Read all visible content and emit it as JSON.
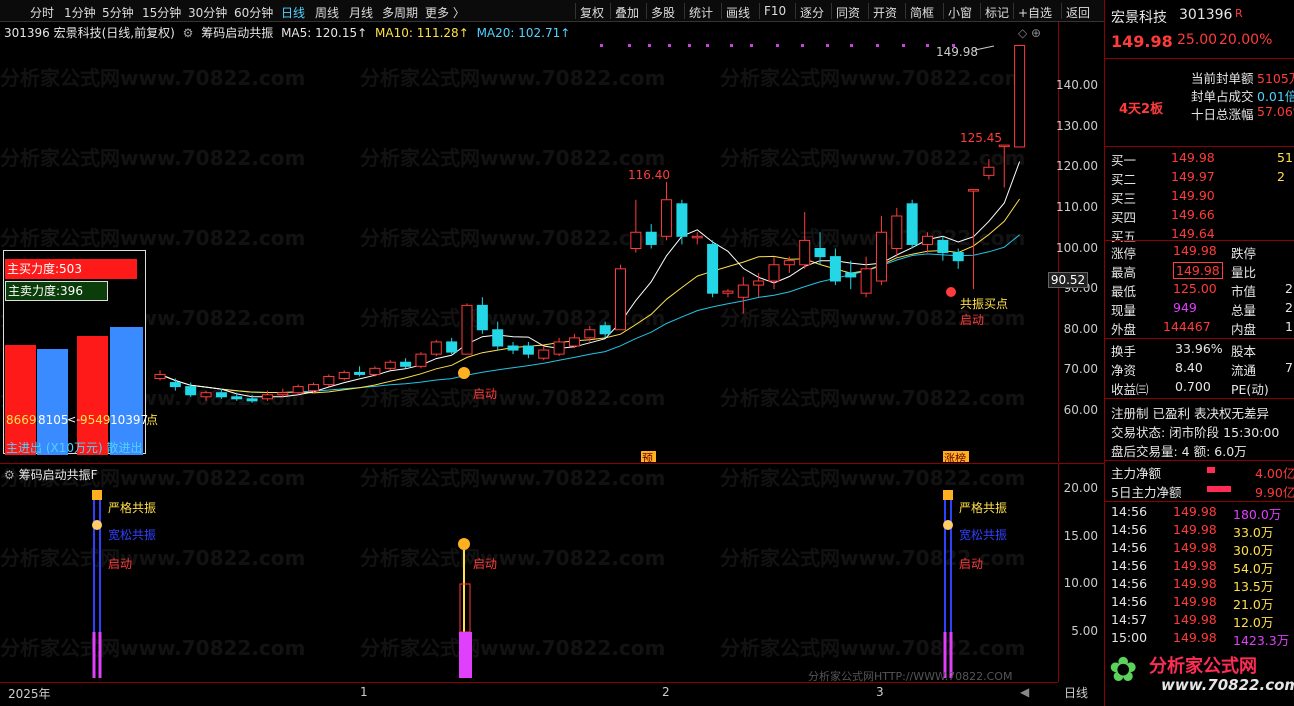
{
  "toolbar": {
    "periods": [
      "分时",
      "1分钟",
      "5分钟",
      "15分钟",
      "30分钟",
      "60分钟",
      "日线",
      "周线",
      "月线",
      "多周期",
      "更多 〉"
    ],
    "active_period": "日线",
    "tools": [
      "复权",
      "叠加",
      "多股",
      "统计",
      "画线",
      "F10",
      "逐分",
      "同资",
      "开资",
      "简框",
      "小窗",
      "标记",
      "+自选",
      "返回"
    ]
  },
  "info_line": {
    "title": "301396 宏景科技(日线,前复权)",
    "formula": "筹码启动共振",
    "ma5": "MA5: 120.15↑",
    "ma10": "MA10: 111.28↑",
    "ma20": "MA20: 102.71↑"
  },
  "main_chart": {
    "y_ticks": [
      "140.00",
      "130.00",
      "120.00",
      "110.00",
      "100.00",
      "90.00",
      "80.00",
      "70.00",
      "60.00"
    ],
    "cursor_price": "90.52",
    "annotations": {
      "high_label": "149.98",
      "peak_label": "116.40",
      "mid_label": "125.45",
      "signal_resonance": "共振买点",
      "signal_start": "启动",
      "signal_start2": "启动",
      "tag_pre": "预",
      "tag_limit": "涨榜"
    },
    "candles": [
      {
        "o": 68,
        "c": 69,
        "h": 70,
        "l": 67.5
      },
      {
        "o": 67,
        "c": 66,
        "h": 68,
        "l": 65
      },
      {
        "o": 66,
        "c": 64,
        "h": 67,
        "l": 63.5
      },
      {
        "o": 63.5,
        "c": 64.5,
        "h": 65,
        "l": 62.5
      },
      {
        "o": 64.5,
        "c": 63.5,
        "h": 65.5,
        "l": 63
      },
      {
        "o": 63.5,
        "c": 63,
        "h": 64.5,
        "l": 62.5
      },
      {
        "o": 63,
        "c": 62.5,
        "h": 64,
        "l": 62
      },
      {
        "o": 63,
        "c": 64,
        "h": 65,
        "l": 62.5
      },
      {
        "o": 64,
        "c": 64.5,
        "h": 65.5,
        "l": 63.5
      },
      {
        "o": 64.5,
        "c": 66,
        "h": 66.5,
        "l": 64
      },
      {
        "o": 65,
        "c": 66.5,
        "h": 67,
        "l": 64.5
      },
      {
        "o": 66.5,
        "c": 68.5,
        "h": 69,
        "l": 66
      },
      {
        "o": 68,
        "c": 69.5,
        "h": 70,
        "l": 67.5
      },
      {
        "o": 69.5,
        "c": 69,
        "h": 71,
        "l": 68.5
      },
      {
        "o": 69,
        "c": 70.5,
        "h": 71,
        "l": 68.5
      },
      {
        "o": 70.5,
        "c": 72,
        "h": 72.5,
        "l": 70
      },
      {
        "o": 72,
        "c": 71,
        "h": 73,
        "l": 70.5
      },
      {
        "o": 71,
        "c": 74,
        "h": 74.5,
        "l": 70.5
      },
      {
        "o": 74,
        "c": 77,
        "h": 77.5,
        "l": 73.5
      },
      {
        "o": 77,
        "c": 74.5,
        "h": 78,
        "l": 74
      },
      {
        "o": 74,
        "c": 86,
        "h": 86.5,
        "l": 74
      },
      {
        "o": 86,
        "c": 80,
        "h": 88,
        "l": 79
      },
      {
        "o": 80,
        "c": 76,
        "h": 82,
        "l": 75
      },
      {
        "o": 76,
        "c": 75,
        "h": 77,
        "l": 74
      },
      {
        "o": 76,
        "c": 74,
        "h": 77,
        "l": 73
      },
      {
        "o": 73,
        "c": 75,
        "h": 76,
        "l": 72.5
      },
      {
        "o": 74,
        "c": 77,
        "h": 78,
        "l": 73.5
      },
      {
        "o": 76,
        "c": 78,
        "h": 79,
        "l": 75.5
      },
      {
        "o": 78,
        "c": 80,
        "h": 81,
        "l": 77
      },
      {
        "o": 81,
        "c": 79,
        "h": 82,
        "l": 78
      },
      {
        "o": 80,
        "c": 95,
        "h": 96,
        "l": 80
      },
      {
        "o": 100,
        "c": 104,
        "h": 112,
        "l": 99
      },
      {
        "o": 104,
        "c": 101,
        "h": 106,
        "l": 100
      },
      {
        "o": 103,
        "c": 112,
        "h": 116.4,
        "l": 102
      },
      {
        "o": 111,
        "c": 103,
        "h": 112,
        "l": 101
      },
      {
        "o": 103,
        "c": 103,
        "h": 104,
        "l": 101
      },
      {
        "o": 101,
        "c": 89,
        "h": 102,
        "l": 88
      },
      {
        "o": 89,
        "c": 89.5,
        "h": 90,
        "l": 88
      },
      {
        "o": 88,
        "c": 91,
        "h": 93,
        "l": 84
      },
      {
        "o": 91,
        "c": 92,
        "h": 94,
        "l": 88
      },
      {
        "o": 92,
        "c": 96,
        "h": 98,
        "l": 90
      },
      {
        "o": 96,
        "c": 97,
        "h": 98,
        "l": 94
      },
      {
        "o": 96,
        "c": 102,
        "h": 109,
        "l": 95
      },
      {
        "o": 100,
        "c": 98,
        "h": 104,
        "l": 96
      },
      {
        "o": 98,
        "c": 92,
        "h": 100,
        "l": 91
      },
      {
        "o": 94,
        "c": 93,
        "h": 97,
        "l": 90
      },
      {
        "o": 89,
        "c": 95,
        "h": 98,
        "l": 88
      },
      {
        "o": 92,
        "c": 104,
        "h": 108,
        "l": 91
      },
      {
        "o": 100,
        "c": 108,
        "h": 110,
        "l": 98
      },
      {
        "o": 111,
        "c": 101,
        "h": 112,
        "l": 100
      },
      {
        "o": 101,
        "c": 103,
        "h": 104,
        "l": 99
      },
      {
        "o": 102,
        "c": 99,
        "h": 103,
        "l": 97
      },
      {
        "o": 99,
        "c": 97,
        "h": 100,
        "l": 95
      },
      {
        "o": 114.5,
        "c": 114.5,
        "h": 114.5,
        "l": 90
      },
      {
        "o": 118,
        "c": 120,
        "h": 122,
        "l": 117
      },
      {
        "o": 125.45,
        "c": 125.45,
        "h": 125.45,
        "l": 115
      },
      {
        "o": 125,
        "c": 149.98,
        "h": 149.98,
        "l": 125
      }
    ]
  },
  "legend": {
    "main_buy": "主买力度:503",
    "main_sell": "主卖力度:396",
    "bar1": "8669",
    "bar2": "8105",
    "bar3": "9549",
    "bar4": "10397",
    "cursor_text": "<--",
    "footer": "主进出 (X10万元) 散进出",
    "tail": "点"
  },
  "sub_chart": {
    "title": "筹码启动共振F",
    "y_ticks": [
      "20.00",
      "15.00",
      "10.00",
      "5.00"
    ],
    "labels": {
      "strict": "严格共振",
      "loose": "宽松共振",
      "start": "启动"
    },
    "footer_watermark": "分析家公式网HTTP://WWW.70822.COM"
  },
  "bottom_axis": {
    "year": "2025年",
    "m1": "1",
    "m2": "2",
    "m3": "3",
    "scale": "日线"
  },
  "right_panel": {
    "name": "宏景科技",
    "code": "301396",
    "badge": "R",
    "price": "149.98",
    "change": "25.00",
    "change_pct": "20.00%",
    "board": "4天2板",
    "seal_amount_label": "当前封单额",
    "seal_amount": "5105万",
    "seal_ratio_label": "封单占成交",
    "seal_ratio": "0.01倍",
    "ten_day_label": "十日总涨幅",
    "ten_day": "57.06%",
    "bids": [
      {
        "label": "买一",
        "price": "149.98",
        "vol": "51"
      },
      {
        "label": "买二",
        "price": "149.97",
        "vol": "2"
      },
      {
        "label": "买三",
        "price": "149.90",
        "vol": ""
      },
      {
        "label": "买四",
        "price": "149.66",
        "vol": ""
      },
      {
        "label": "买五",
        "price": "149.64",
        "vol": ""
      }
    ],
    "stats1": [
      {
        "l": "涨停",
        "v": "149.98",
        "l2": "跌停",
        "v2": ""
      },
      {
        "l": "最高",
        "v": "149.98",
        "l2": "量比",
        "v2": ""
      },
      {
        "l": "最低",
        "v": "125.00",
        "l2": "市值",
        "v2": "2"
      },
      {
        "l": "现量",
        "v": "949",
        "l2": "总量",
        "v2": "2"
      },
      {
        "l": "外盘",
        "v": "144467",
        "l2": "内盘",
        "v2": "1"
      }
    ],
    "stats2": [
      {
        "l": "换手",
        "v": "33.96%",
        "l2": "股本",
        "v2": ""
      },
      {
        "l": "净资",
        "v": "8.40",
        "l2": "流通",
        "v2": "7"
      },
      {
        "l": "收益㈢",
        "v": "0.700",
        "l2": "PE(动)",
        "v2": ""
      }
    ],
    "tags": "注册制  已盈利  表决权无差异",
    "trade_status": "交易状态: 闭市阶段 15:30:00",
    "after_hours": "盘后交易量: 4  额: 6.0万",
    "main_net_label": "主力净额",
    "main_net": "4.00亿",
    "five_day_label": "5日主力净额",
    "five_day": "9.90亿",
    "ticks": [
      {
        "t": "14:56",
        "p": "149.98",
        "v": "180.0万"
      },
      {
        "t": "14:56",
        "p": "149.98",
        "v": "33.0万"
      },
      {
        "t": "14:56",
        "p": "149.98",
        "v": "30.0万"
      },
      {
        "t": "14:56",
        "p": "149.98",
        "v": "54.0万"
      },
      {
        "t": "14:56",
        "p": "149.98",
        "v": "13.5万"
      },
      {
        "t": "14:56",
        "p": "149.98",
        "v": "21.0万"
      },
      {
        "t": "14:57",
        "p": "149.98",
        "v": "12.0万"
      },
      {
        "t": "15:00",
        "p": "149.98",
        "v": "1423.3万"
      }
    ],
    "logo_text": "分析家公式网",
    "logo_url": "www.70822.com"
  },
  "watermark_text": "分析家公式网www.70822.com",
  "colors": {
    "up": "#ff3b3b",
    "down": "#23d7e6",
    "ma5": "#ffffff",
    "ma10": "#ffe04a",
    "ma20": "#23c4e6",
    "accent": "#4fd2ff"
  }
}
